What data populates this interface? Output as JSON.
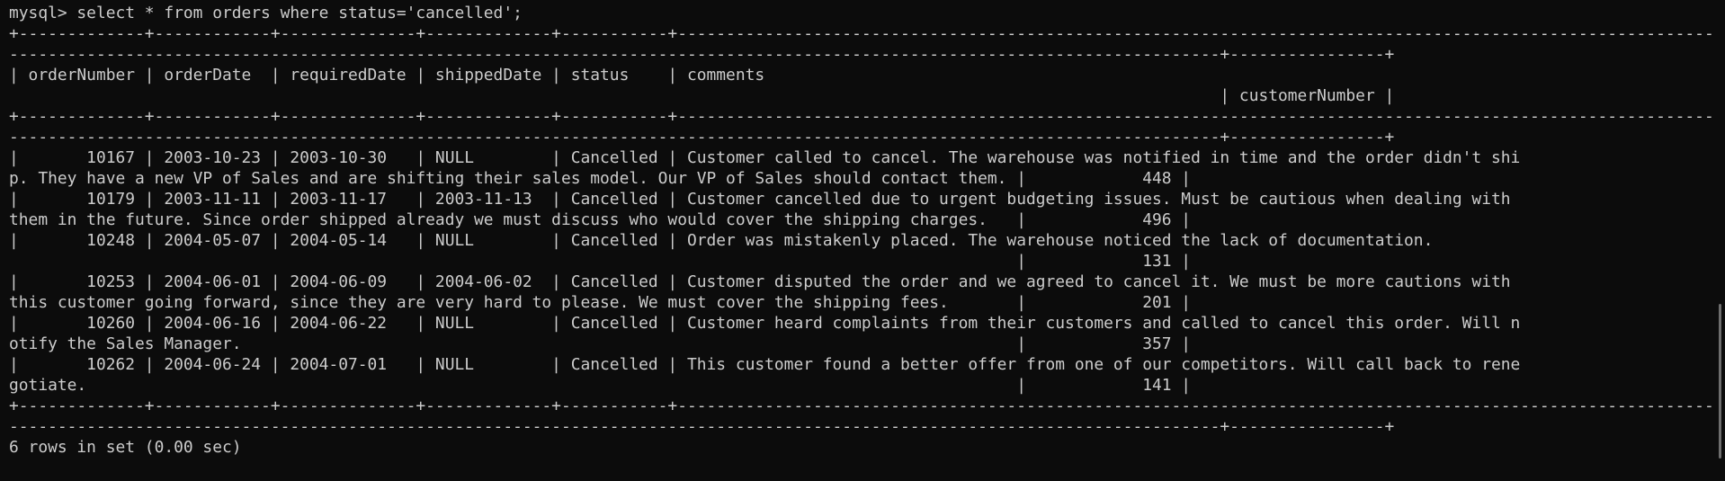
{
  "terminal": {
    "lines": [
      "mysql> select * from orders where status='cancelled';",
      "+-------------+------------+--------------+-------------+-----------+--------------------------------------------------------------------------------------------------------------------------------------------------------------------------------------------------------------------------------------------------------------------------------------",
      "-----------------------------------------------------------------------------------------------------------------------------+----------------+",
      "| orderNumber | orderDate  | requiredDate | shippedDate | status    | comments",
      "                                                                                                                             | customerNumber |",
      "+-------------+------------+--------------+-------------+-----------+--------------------------------------------------------------------------------------------------------------------------------------------------------------------------------------------------------------------------------------------------------------------------------------",
      "-----------------------------------------------------------------------------------------------------------------------------+----------------+",
      "|       10167 | 2003-10-23 | 2003-10-30   | NULL        | Cancelled | Customer called to cancel. The warehouse was notified in time and the order didn't shi",
      "p. They have a new VP of Sales and are shifting their sales model. Our VP of Sales should contact them. |            448 |",
      "|       10179 | 2003-11-11 | 2003-11-17   | 2003-11-13  | Cancelled | Customer cancelled due to urgent budgeting issues. Must be cautious when dealing with",
      "them in the future. Since order shipped already we must discuss who would cover the shipping charges.   |            496 |",
      "|       10248 | 2004-05-07 | 2004-05-14   | NULL        | Cancelled | Order was mistakenly placed. The warehouse noticed the lack of documentation.",
      "                                                                                                        |            131 |",
      "|       10253 | 2004-06-01 | 2004-06-09   | 2004-06-02  | Cancelled | Customer disputed the order and we agreed to cancel it. We must be more cautions with",
      "this customer going forward, since they are very hard to please. We must cover the shipping fees.       |            201 |",
      "|       10260 | 2004-06-16 | 2004-06-22   | NULL        | Cancelled | Customer heard complaints from their customers and called to cancel this order. Will n",
      "otify the Sales Manager.                                                                                |            357 |",
      "|       10262 | 2004-06-24 | 2004-07-01   | NULL        | Cancelled | This customer found a better offer from one of our competitors. Will call back to rene",
      "gotiate.                                                                                                |            141 |",
      "+-------------+------------+--------------+-------------+-----------+--------------------------------------------------------------------------------------------------------------------------------------------------------------------------------------------------------------------------------------------------------------------------------------",
      "-----------------------------------------------------------------------------------------------------------------------------+----------------+",
      "6 rows in set (0.00 sec)"
    ]
  },
  "colors": {
    "background": "#0c0c0c",
    "foreground": "#cccccc",
    "scrollbar_thumb": "#6e6e6e"
  }
}
